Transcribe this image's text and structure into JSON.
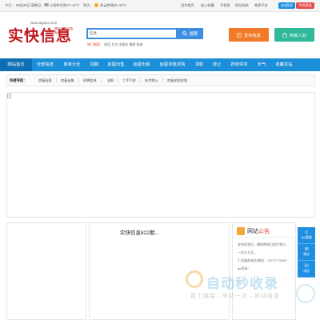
{
  "topbar": {
    "today_label": "今天：",
    "date": "06月29日 星期日",
    "today_weather": "小雨转大雨27~14°C",
    "tomorrow_label": "明天：",
    "tomorrow_weather": "多云转晴20~10°C",
    "links": [
      "设为首页",
      "加入收藏",
      "手机版",
      "网站导航",
      "商家平台"
    ],
    "qq_label": "QQ登录",
    "mobile_label": "手机登录"
  },
  "logo": {
    "url": "www.agsixx.com",
    "title": "实快信息",
    "slogan": "便民·快捷 信息·免费"
  },
  "search": {
    "category": "信息",
    "placeholder": "",
    "button": "搜索",
    "hot_label": "热门搜索：",
    "hot_words": [
      "电话",
      "北京",
      "出租车",
      "兼职",
      "装修"
    ]
  },
  "actions": {
    "publish": "发布信息",
    "merchant": "商家入驻"
  },
  "nav": [
    "网站首页",
    "全部信息",
    "商家大全",
    "招聘",
    "房屋出售",
    "房屋出租",
    "房屋求租求购",
    "求职",
    "转让",
    "药材供求",
    "天气",
    "收藏本站"
  ],
  "quick": {
    "label": "快捷导航：",
    "items": [
      "房屋出租",
      "房屋出售",
      "招聘信息",
      "求职",
      "二手汽车",
      "技术转让",
      "房屋求租求购"
    ]
  },
  "panels": {
    "center_title": "实快信息822期..."
  },
  "notice": {
    "title_a": "网站",
    "title_b": "公告",
    "lines": [
      "发布信息后，模拟审核日同步发行，",
      "一次九七天。",
      "广告服务电话/微信：13772770000",
      "qq号码："
    ]
  },
  "side": {
    "qq": "QQ客服",
    "wechat": "微信",
    "phone": "电话"
  },
  "watermark": {
    "main": "自动秒收录",
    "sub": "数上链接→来访一次→自动收录"
  },
  "colors": {
    "brand_blue": "#1d8ed8",
    "logo_red": "#c0181f",
    "publish_orange": "#f07a27",
    "merchant_green": "#2fb89a"
  }
}
